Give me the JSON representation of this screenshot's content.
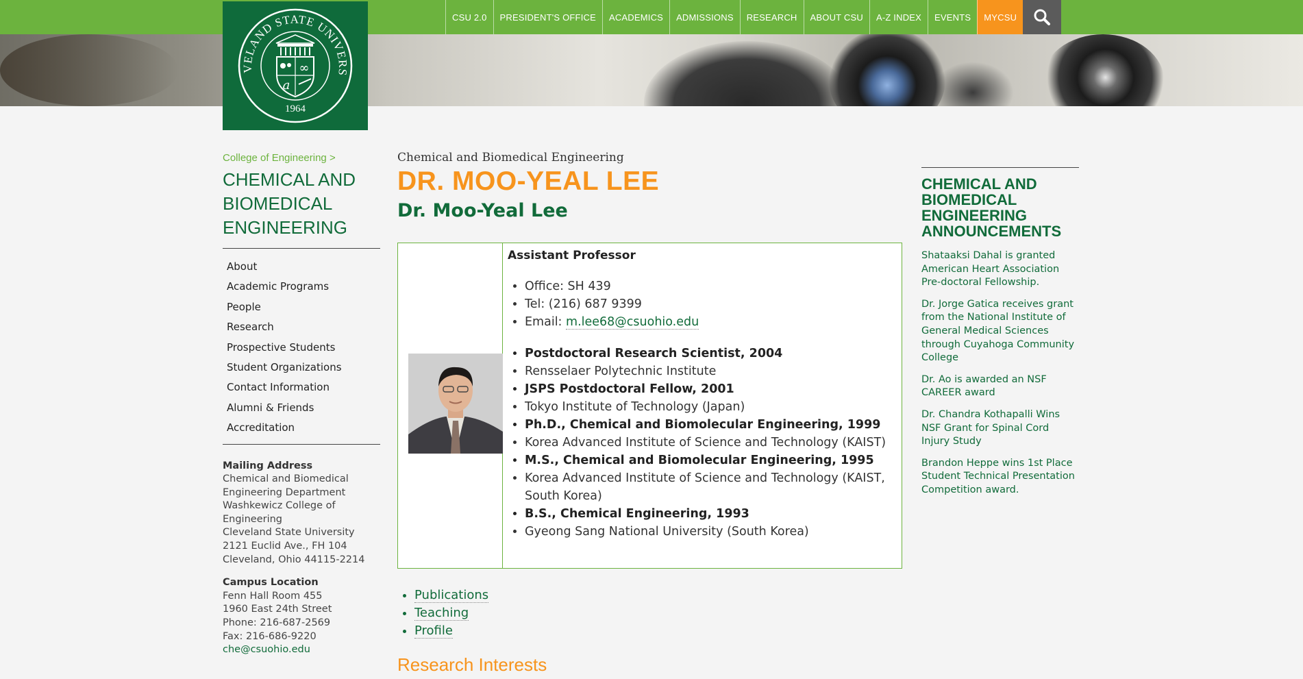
{
  "header": {
    "nav": [
      "CSU 2.0",
      "PRESIDENT'S OFFICE",
      "ACADEMICS",
      "ADMISSIONS",
      "RESEARCH",
      "ABOUT CSU",
      "A-Z INDEX",
      "EVENTS",
      "MYCSU"
    ],
    "logo": {
      "arc_text": "CLEVELAND STATE UNIVERSITY",
      "year": "1964"
    },
    "search_icon": "search-icon",
    "colors": {
      "green": "#6cb33e",
      "dark_green": "#0f6b3b",
      "orange": "#f7941d",
      "gray": "#5b5b5b"
    }
  },
  "sidebar": {
    "breadcrumb": "College of Engineering >",
    "title_lines": [
      "CHEMICAL AND",
      "BIOMEDICAL",
      "ENGINEERING"
    ],
    "nav": [
      "About",
      "Academic Programs",
      "People",
      "Research",
      "Prospective Students",
      "Student Organizations",
      "Contact Information",
      "Alumni & Friends",
      "Accreditation"
    ],
    "mailing": {
      "heading": "Mailing Address",
      "lines": [
        "Chemical and Biomedical",
        "Engineering Department",
        "Washkewicz College of",
        "Engineering",
        "Cleveland State University",
        "2121 Euclid Ave., FH 104",
        "Cleveland, Ohio 44115-2214"
      ]
    },
    "campus": {
      "heading": "Campus Location",
      "lines": [
        "Fenn Hall Room 455",
        "1960 East 24th Street",
        "Phone: 216-687-2569",
        "Fax: 216-686-9220"
      ],
      "email": "che@csuohio.edu"
    }
  },
  "main": {
    "subtitle": "Chemical and Biomedical Engineering",
    "name": "DR. MOO-YEAL LEE",
    "name_sub": "Dr. Moo-Yeal Lee",
    "rank": "Assistant Professor",
    "contact": {
      "office": "Office: SH 439",
      "tel": "Tel: (216) 687 9399",
      "email_label": "Email: ",
      "email": "m.lee68@csuohio.edu"
    },
    "education": [
      {
        "text": "Postdoctoral Research Scientist, 2004",
        "bold": true
      },
      {
        "text": "Rensselaer Polytechnic Institute",
        "bold": false
      },
      {
        "text": "JSPS Postdoctoral Fellow, 2001",
        "bold": true
      },
      {
        "text": "Tokyo Institute of Technology (Japan)",
        "bold": false
      },
      {
        "text": "Ph.D., Chemical and Biomolecular Engineering, 1999",
        "bold": true
      },
      {
        "text": "Korea Advanced Institute of Science and Technology (KAIST)",
        "bold": false
      },
      {
        "text": "M.S., Chemical and Biomolecular Engineering, 1995",
        "bold": true
      },
      {
        "text": "Korea Advanced Institute of Science and Technology (KAIST, South Korea)",
        "bold": false
      },
      {
        "text": "B.S., Chemical Engineering, 1993",
        "bold": true
      },
      {
        "text": "Gyeong Sang National University (South Korea)",
        "bold": false
      }
    ],
    "links": [
      "Publications",
      "Teaching",
      "Profile"
    ],
    "research_heading": "Research Interests"
  },
  "announcements": {
    "title_lines": [
      "CHEMICAL AND",
      "BIOMEDICAL",
      "ENGINEERING",
      "ANNOUNCEMENTS"
    ],
    "items": [
      "Shataaksi Dahal is granted American Heart Association Pre-doctoral Fellowship.",
      "Dr. Jorge Gatica receives grant from the National Institute of General Medical Sciences through Cuyahoga Community College",
      "Dr. Ao is awarded an NSF CAREER award",
      "Dr. Chandra Kothapalli Wins NSF Grant for Spinal Cord Injury Study",
      "Brandon Heppe wins 1st Place Student Technical Presentation Competition award."
    ]
  }
}
